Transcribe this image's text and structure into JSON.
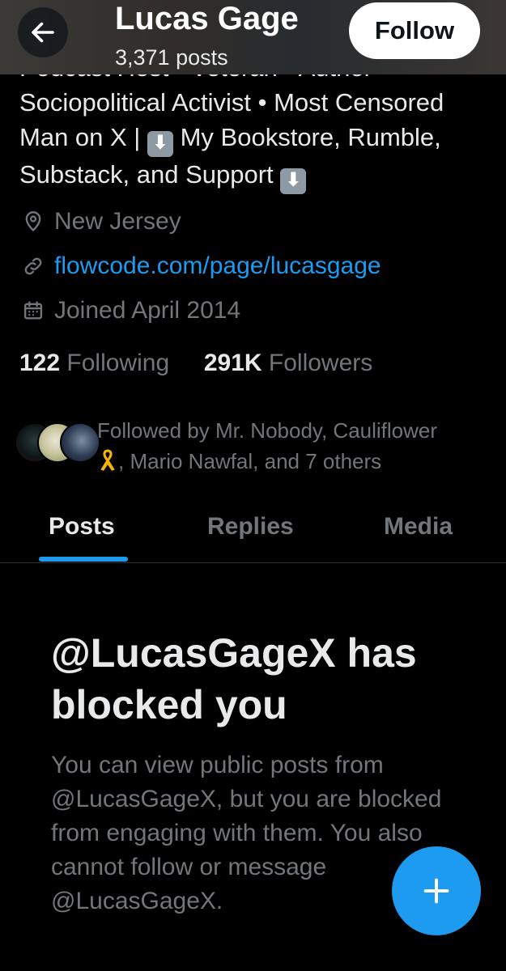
{
  "header": {
    "name": "Lucas Gage",
    "posts_count": "3,371 posts",
    "follow_label": "Follow",
    "back_icon": "arrow-left-icon"
  },
  "bio": {
    "partial_top_line": "Podcast Host · Veteran · Author",
    "line1": "Sociopolitical Activist • Most Censored",
    "line2_a": "Man on X |",
    "line2_b": "My Bookstore, Rumble,",
    "line3": "Substack, and Support",
    "arrow_emoji": "⬇"
  },
  "meta": {
    "location": "New Jersey",
    "link": "flowcode.com/page/lucasgage",
    "joined": "Joined April 2014",
    "location_icon": "location-pin-icon",
    "link_icon": "link-icon",
    "calendar_icon": "calendar-icon"
  },
  "stats": {
    "following_count": "122",
    "following_label": "Following",
    "followers_count": "291K",
    "followers_label": "Followers"
  },
  "followed_by": {
    "line1": "Followed by Mr. Nobody, Cauliflower",
    "line2": ", Mario Nawfal, and 7 others"
  },
  "tabs": [
    {
      "label": "Posts",
      "active": true
    },
    {
      "label": "Replies",
      "active": false
    },
    {
      "label": "Media",
      "active": false
    }
  ],
  "blocked": {
    "title": "@LucasGageX has blocked you",
    "body": "You can view public posts from @LucasGageX, but you are blocked from engaging with them. You also cannot follow or message @LucasGageX."
  },
  "fab": {
    "icon": "plus-icon"
  },
  "colors": {
    "background": "#000000",
    "primary_text": "#e7e9ea",
    "secondary_text": "#71767b",
    "accent": "#1d9bf0"
  }
}
